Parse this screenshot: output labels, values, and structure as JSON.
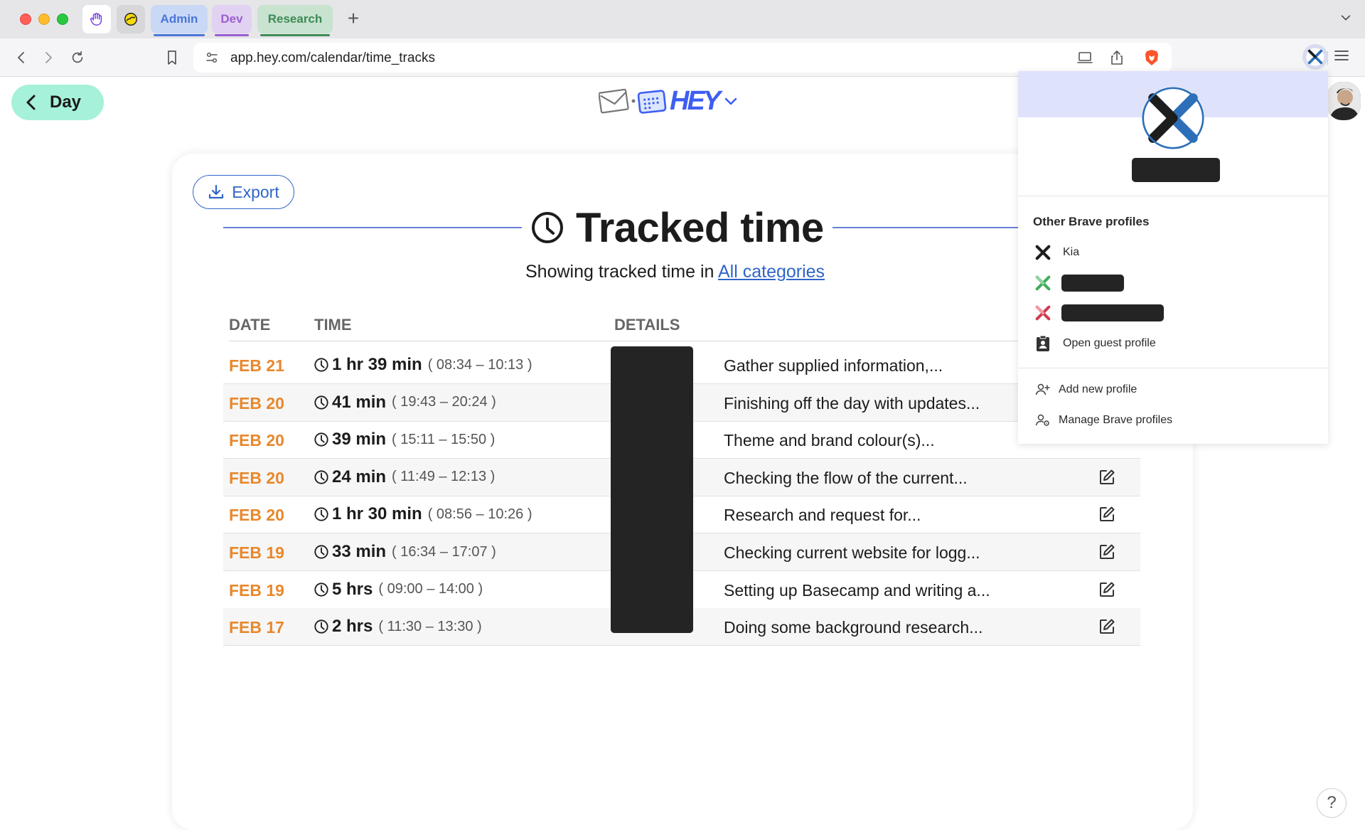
{
  "browser": {
    "tab_groups": [
      {
        "label": "Admin",
        "color": "#4a76d8"
      },
      {
        "label": "Dev",
        "color": "#9a5fd1"
      },
      {
        "label": "Research",
        "color": "#3e8a56"
      }
    ],
    "new_tab_label": "+",
    "url": "app.hey.com/calendar/time_tracks"
  },
  "page": {
    "back_label": "Day",
    "logo_text": "HEY",
    "export_label": "Export",
    "title": "Tracked time",
    "subtitle_prefix": "Showing tracked time in",
    "subtitle_link": "All categories",
    "accent_color": "#e8882c",
    "link_color": "#2f65c9"
  },
  "table": {
    "headers": {
      "date": "DATE",
      "time": "TIME",
      "details": "DETAILS"
    },
    "rows": [
      {
        "date": "FEB 21",
        "duration": "1 hr 39 min",
        "range": "( 08:34 – 10:13 )",
        "detail": "Gather supplied information,..."
      },
      {
        "date": "FEB 20",
        "duration": "41 min",
        "range": "( 19:43 – 20:24 )",
        "detail": "Finishing off the day with updates..."
      },
      {
        "date": "FEB 20",
        "duration": "39 min",
        "range": "( 15:11 – 15:50 )",
        "detail": "Theme and brand colour(s)..."
      },
      {
        "date": "FEB 20",
        "duration": "24 min",
        "range": "( 11:49 – 12:13 )",
        "detail": "Checking the flow of the current..."
      },
      {
        "date": "FEB 20",
        "duration": "1 hr 30 min",
        "range": "( 08:56 – 10:26 )",
        "detail": "Research and request for..."
      },
      {
        "date": "FEB 19",
        "duration": "33 min",
        "range": "( 16:34 – 17:07 )",
        "detail": "Checking current website for logg..."
      },
      {
        "date": "FEB 19",
        "duration": "5 hrs",
        "range": "( 09:00 – 14:00 )",
        "detail": "Setting up Basecamp and writing a..."
      },
      {
        "date": "FEB 17",
        "duration": "2 hrs",
        "range": "( 11:30 – 13:30 )",
        "detail": "Doing some background research..."
      }
    ]
  },
  "profile_menu": {
    "section_title": "Other Brave profiles",
    "profiles": [
      {
        "name": "Kia"
      }
    ],
    "guest_label": "Open guest profile",
    "add_label": "Add new profile",
    "manage_label": "Manage Brave profiles"
  },
  "help_label": "?"
}
